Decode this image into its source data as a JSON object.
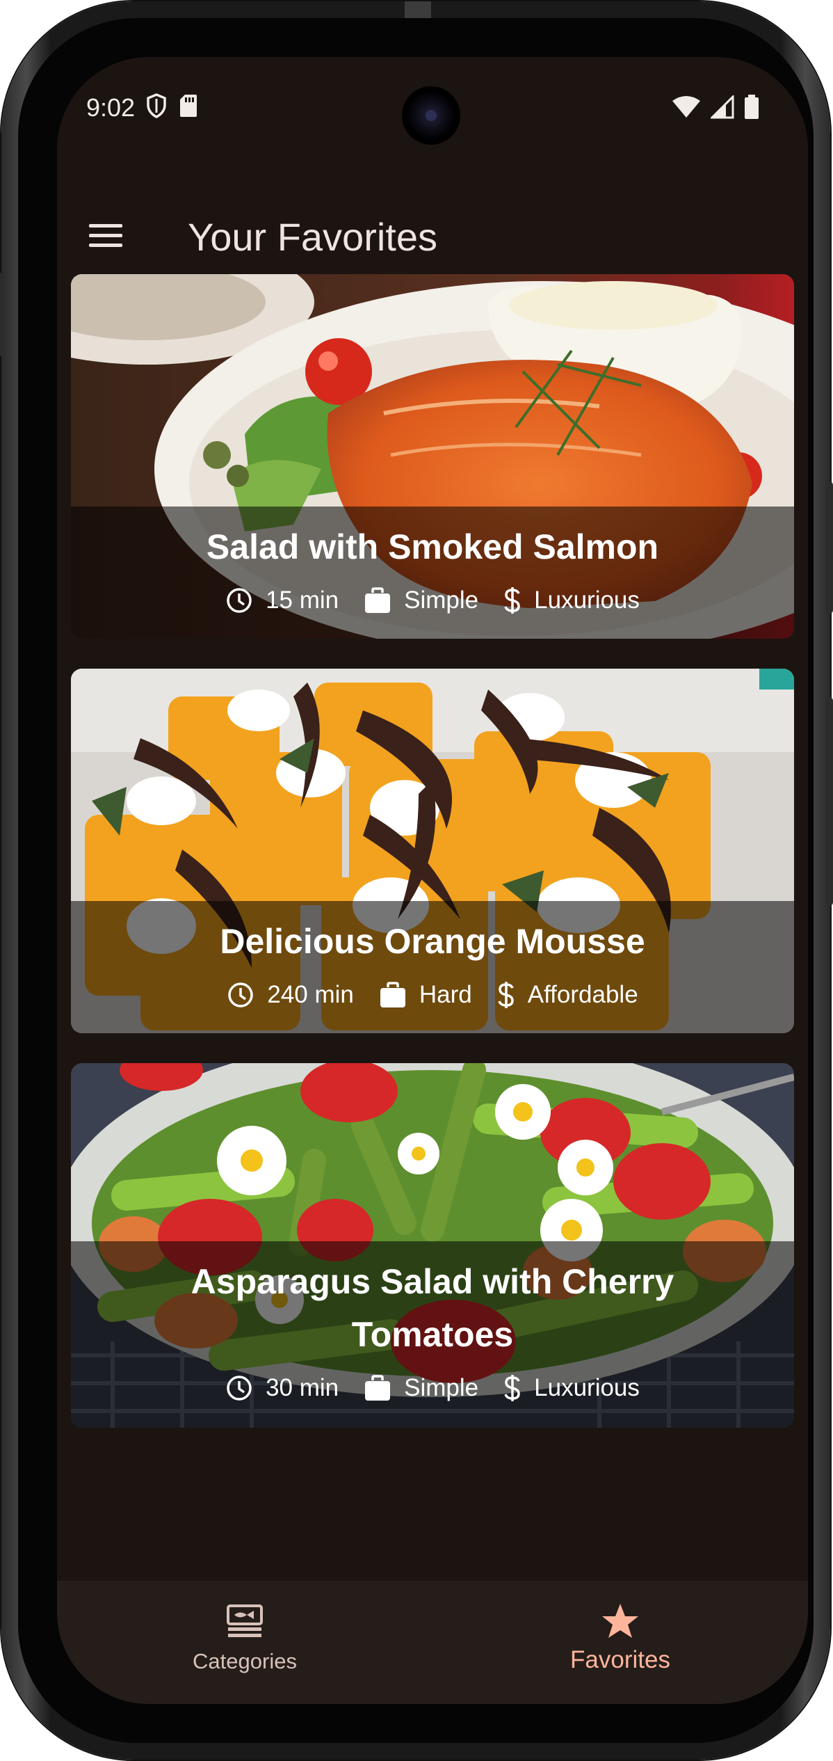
{
  "status_bar": {
    "time": "9:02",
    "left_icons": [
      "shield-icon",
      "sd-card-icon"
    ],
    "right_icons": [
      "wifi-icon",
      "signal-icon",
      "battery-icon"
    ]
  },
  "app_bar": {
    "title": "Your Favorites",
    "menu_icon": "hamburger-menu-icon"
  },
  "meals": [
    {
      "title": "Salad with Smoked Salmon",
      "duration": "15 min",
      "complexity": "Simple",
      "affordability": "Luxurious",
      "image": "smoked salmon salad photo"
    },
    {
      "title": "Delicious Orange Mousse",
      "duration": "240 min",
      "complexity": "Hard",
      "affordability": "Affordable",
      "image": "orange mousse cups photo"
    },
    {
      "title": "Asparagus Salad with Cherry Tomatoes",
      "duration": "30 min",
      "complexity": "Simple",
      "affordability": "Luxurious",
      "image": "asparagus strawberry salad photo"
    }
  ],
  "bottom_nav": {
    "items": [
      {
        "label": "Categories",
        "icon": "set-meal-icon",
        "active": false
      },
      {
        "label": "Favorites",
        "icon": "star-icon",
        "active": true
      }
    ]
  },
  "colors": {
    "background": "#1c1411",
    "title_text": "#efe4df",
    "active_accent": "#ffb59c",
    "nav_background": "#251d19"
  }
}
